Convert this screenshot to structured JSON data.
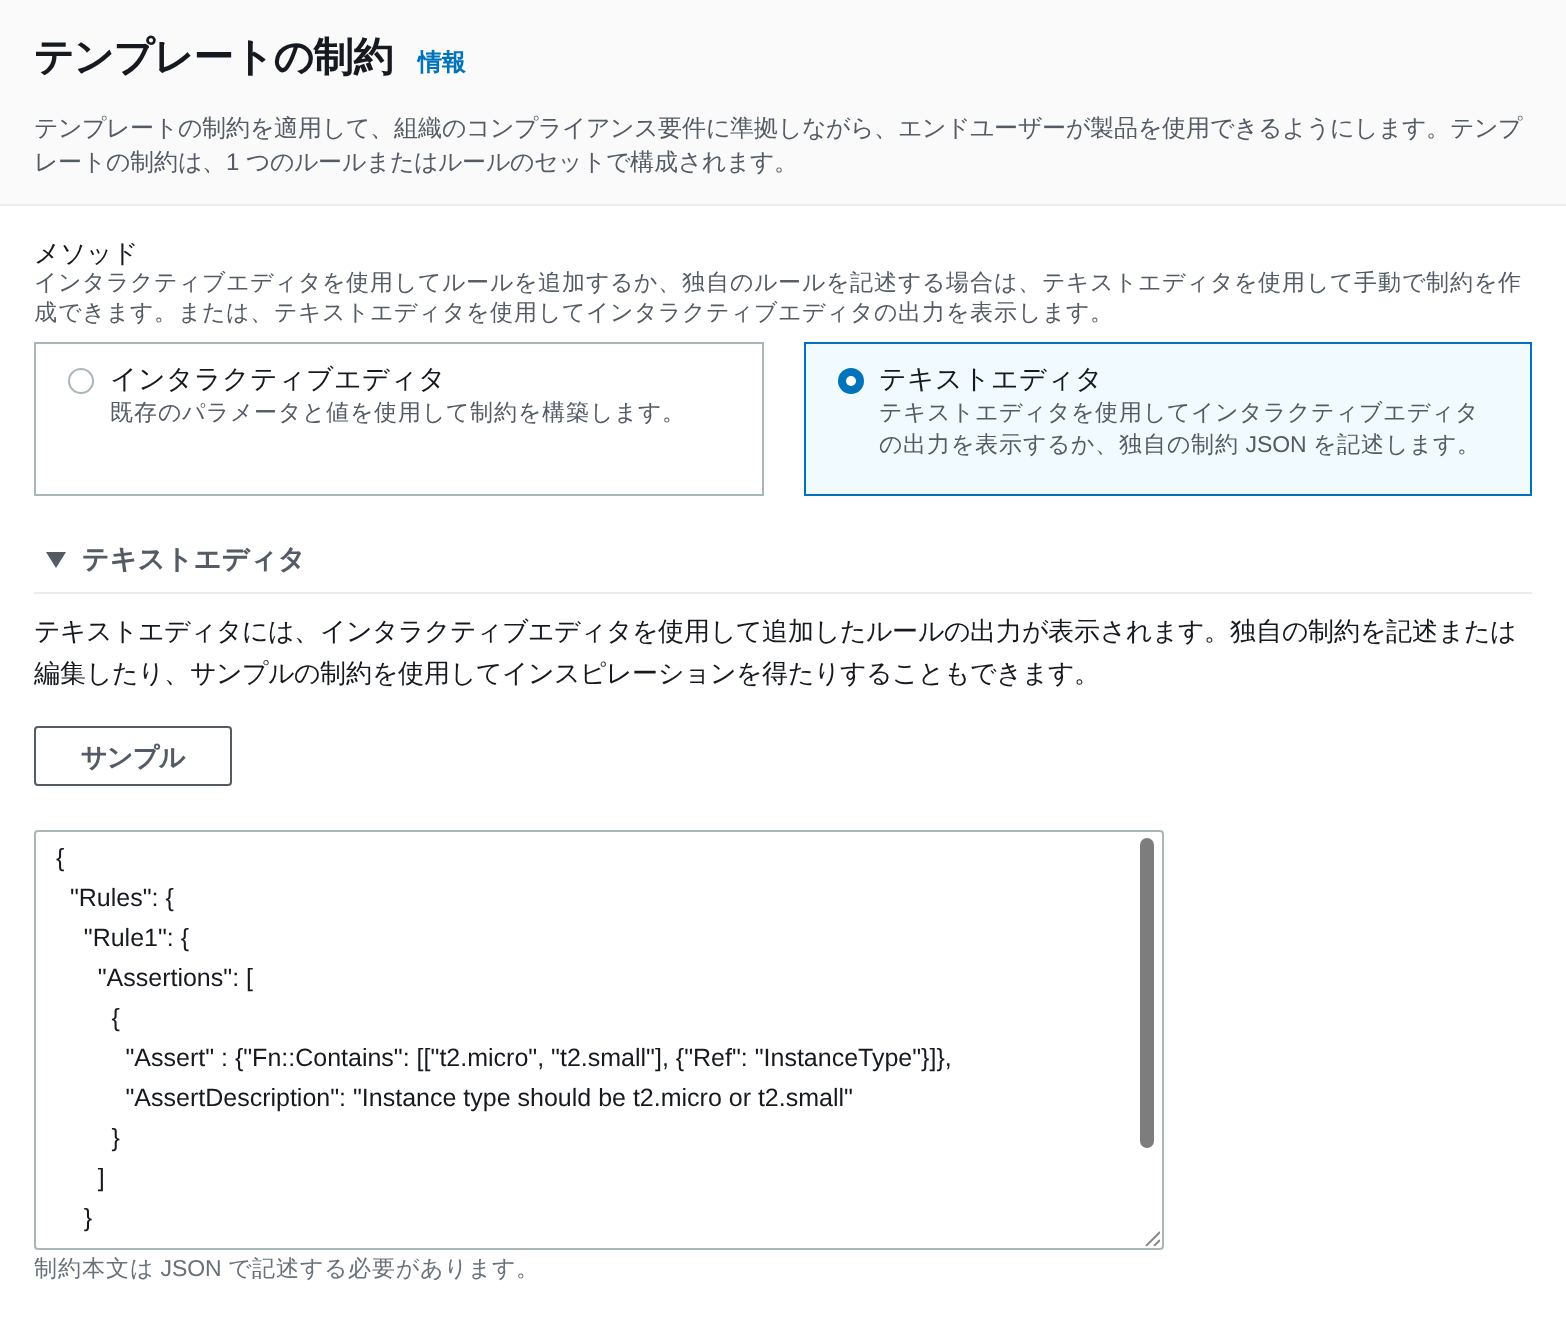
{
  "header": {
    "title": "テンプレートの制約",
    "info_link": "情報",
    "description": "テンプレートの制約を適用して、組織のコンプライアンス要件に準拠しながら、エンドユーザーが製品を使用できるようにします。テンプレートの制約は、1 つのルールまたはルールのセットで構成されます。"
  },
  "method": {
    "label": "メソッド",
    "description": "インタラクティブエディタを使用してルールを追加するか、独自のルールを記述する場合は、テキストエディタを使用して手動で制約を作成できます。または、テキストエディタを使用してインタラクティブエディタの出力を表示します。",
    "options": [
      {
        "title": "インタラクティブエディタ",
        "description": "既存のパラメータと値を使用して制約を構築します。",
        "selected": false
      },
      {
        "title": "テキストエディタ",
        "description": "テキストエディタを使用してインタラクティブエディタの出力を表示するか、独自の制約 JSON を記述します。",
        "selected": true
      }
    ]
  },
  "text_editor": {
    "heading": "テキストエディタ",
    "expanded": true,
    "description": "テキストエディタには、インタラクティブエディタを使用して追加したルールの出力が表示されます。独自の制約を記述または編集したり、サンプルの制約を使用してインスピレーションを得たりすることもできます。",
    "sample_button": "サンプル",
    "code_lines": [
      "{",
      "  \"Rules\": {",
      "    \"Rule1\": {",
      "      \"Assertions\": [",
      "        {",
      "          \"Assert\" : {\"Fn::Contains\": [[\"t2.micro\", \"t2.small\"], {\"Ref\": \"InstanceType\"}]},",
      "          \"AssertDescription\": \"Instance type should be t2.micro or t2.small\"",
      "        }",
      "      ]",
      "    }"
    ],
    "hint": "制約本文は JSON で記述する必要があります。"
  }
}
